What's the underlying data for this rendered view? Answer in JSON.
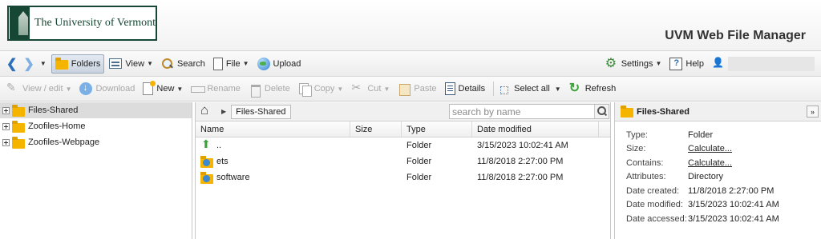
{
  "header": {
    "logo_text": "The University of Vermont",
    "app_title": "UVM Web File Manager"
  },
  "toolbar_main": {
    "folders": "Folders",
    "view": "View",
    "search": "Search",
    "file": "File",
    "upload": "Upload",
    "settings": "Settings",
    "help": "Help"
  },
  "toolbar_actions": {
    "view_edit": "View / edit",
    "download": "Download",
    "new": "New",
    "rename": "Rename",
    "delete": "Delete",
    "copy": "Copy",
    "cut": "Cut",
    "paste": "Paste",
    "details": "Details",
    "select_all": "Select all",
    "refresh": "Refresh"
  },
  "tree": {
    "items": [
      {
        "label": "Files-Shared"
      },
      {
        "label": "Zoofiles-Home"
      },
      {
        "label": "Zoofiles-Webpage"
      }
    ]
  },
  "breadcrumb": {
    "current": "Files-Shared"
  },
  "search": {
    "placeholder": "search by name"
  },
  "file_list": {
    "columns": {
      "name": "Name",
      "size": "Size",
      "type": "Type",
      "modified": "Date modified"
    },
    "rows": [
      {
        "name": "..",
        "size": "",
        "type": "Folder",
        "modified": "3/15/2023 10:02:41 AM"
      },
      {
        "name": "ets",
        "size": "",
        "type": "Folder",
        "modified": "11/8/2018 2:27:00 PM"
      },
      {
        "name": "software",
        "size": "",
        "type": "Folder",
        "modified": "11/8/2018 2:27:00 PM"
      }
    ]
  },
  "details": {
    "title": "Files-Shared",
    "labels": {
      "type": "Type:",
      "size": "Size:",
      "contains": "Contains:",
      "attributes": "Attributes:",
      "created": "Date created:",
      "modified": "Date modified:",
      "accessed": "Date accessed:"
    },
    "values": {
      "type": "Folder",
      "size": "Calculate...",
      "contains": "Calculate...",
      "attributes": "Directory",
      "created": "11/8/2018 2:27:00 PM",
      "modified": "3/15/2023 10:02:41 AM",
      "accessed": "3/15/2023 10:02:41 AM"
    }
  },
  "colors": {
    "uvm_green": "#154734",
    "folder_yellow": "#f4b400",
    "nav_blue": "#2a6fb7"
  }
}
